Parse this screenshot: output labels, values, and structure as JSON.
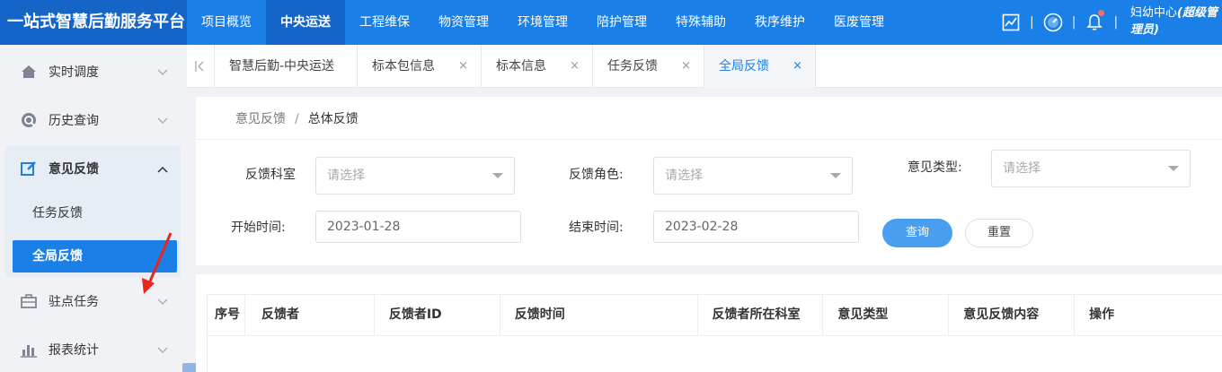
{
  "app": {
    "brand": "一站式智慧后勤服务平台",
    "accent": "#1a80e8"
  },
  "topnav": {
    "items": [
      {
        "label": "项目概览"
      },
      {
        "label": "中央运送",
        "active": true
      },
      {
        "label": "工程维保"
      },
      {
        "label": "物资管理"
      },
      {
        "label": "环境管理"
      },
      {
        "label": "陪护管理"
      },
      {
        "label": "特殊辅助"
      },
      {
        "label": "秩序维护"
      },
      {
        "label": "医废管理"
      }
    ]
  },
  "user": {
    "name": "妇幼中心",
    "role_line1": "(超级管",
    "role_line2": "理员)",
    "separator": "|"
  },
  "sidebar": {
    "items": [
      {
        "label": "实时调度",
        "icon": "home-icon"
      },
      {
        "label": "历史查询",
        "icon": "history-icon"
      },
      {
        "label": "意见反馈",
        "icon": "edit-icon",
        "expanded": true
      },
      {
        "label": "驻点任务",
        "icon": "briefcase-icon"
      },
      {
        "label": "报表统计",
        "icon": "bar-chart-icon"
      }
    ],
    "subitems": [
      {
        "label": "任务反馈"
      },
      {
        "label": "全局反馈",
        "active": true
      }
    ]
  },
  "tabs": [
    {
      "label": "智慧后勤-中央运送"
    },
    {
      "label": "标本包信息",
      "close": "×"
    },
    {
      "label": "标本信息",
      "close": "×"
    },
    {
      "label": "任务反馈",
      "close": "×"
    },
    {
      "label": "全局反馈",
      "close": "×",
      "active": true
    }
  ],
  "breadcrumb": {
    "parent": "意见反馈",
    "separator": "/",
    "current": "总体反馈"
  },
  "filters": {
    "dept_label": "反馈科室",
    "dept_placeholder": "请选择",
    "role_label": "反馈角色:",
    "role_placeholder": "请选择",
    "type_label": "意见类型:",
    "type_placeholder": "请选择",
    "start_label": "开始时间:",
    "start_value": "2023-01-28",
    "end_label": "结束时间:",
    "end_value": "2023-02-28",
    "query_label": "查询",
    "reset_label": "重置"
  },
  "table": {
    "columns": [
      "序号",
      "反馈者",
      "反馈者ID",
      "反馈时间",
      "反馈者所在科室",
      "意见类型",
      "意见反馈内容",
      "操作"
    ]
  }
}
